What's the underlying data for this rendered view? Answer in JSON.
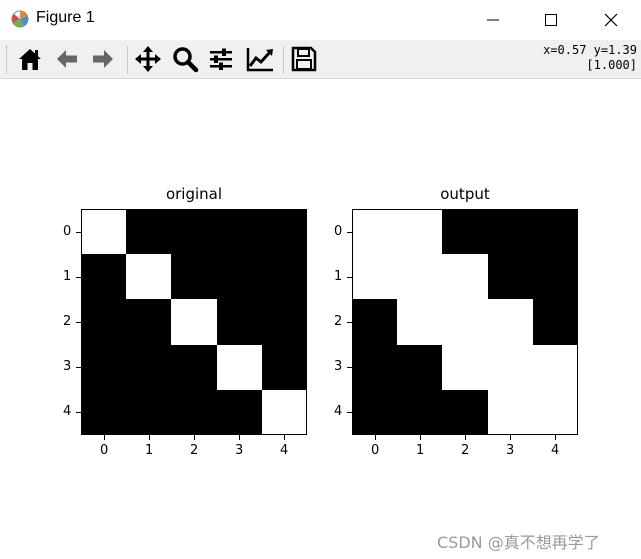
{
  "window": {
    "title": "Figure 1",
    "icon": "matplotlib-logo-icon",
    "controls": [
      "minimize-icon",
      "maximize-icon",
      "close-icon"
    ]
  },
  "toolbar": {
    "tools": [
      {
        "name": "home-icon"
      },
      {
        "name": "back-arrow-icon"
      },
      {
        "name": "forward-arrow-icon"
      },
      {
        "name": "pan-move-icon"
      },
      {
        "name": "zoom-magnifier-icon"
      },
      {
        "name": "subplots-config-icon"
      },
      {
        "name": "edit-axes-icon"
      },
      {
        "name": "save-floppy-icon"
      }
    ],
    "coords_line1": "x=0.57 y=1.39",
    "coords_line2": "[1.000]"
  },
  "chart_data": [
    {
      "type": "heatmap",
      "title": "original",
      "x_ticks": [
        "0",
        "1",
        "2",
        "3",
        "4"
      ],
      "y_ticks": [
        "0",
        "1",
        "2",
        "3",
        "4"
      ],
      "colormap": {
        "0": "#000000",
        "1": "#ffffff"
      },
      "values": [
        [
          1,
          0,
          0,
          0,
          0
        ],
        [
          0,
          1,
          0,
          0,
          0
        ],
        [
          0,
          0,
          1,
          0,
          0
        ],
        [
          0,
          0,
          0,
          1,
          0
        ],
        [
          0,
          0,
          0,
          0,
          1
        ]
      ]
    },
    {
      "type": "heatmap",
      "title": "output",
      "x_ticks": [
        "0",
        "1",
        "2",
        "3",
        "4"
      ],
      "y_ticks": [
        "0",
        "1",
        "2",
        "3",
        "4"
      ],
      "colormap": {
        "0": "#000000",
        "1": "#ffffff"
      },
      "values": [
        [
          1,
          1,
          0,
          0,
          0
        ],
        [
          1,
          1,
          1,
          0,
          0
        ],
        [
          0,
          1,
          1,
          1,
          0
        ],
        [
          0,
          0,
          1,
          1,
          1
        ],
        [
          0,
          0,
          0,
          1,
          1
        ]
      ]
    }
  ],
  "watermark": "CSDN @真不想再学了"
}
